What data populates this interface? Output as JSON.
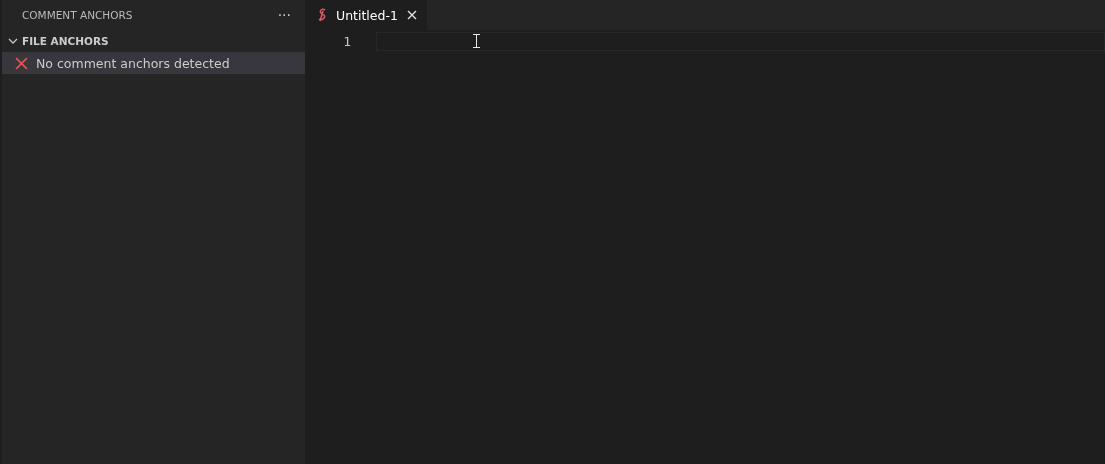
{
  "sidebar": {
    "title": "COMMENT ANCHORS",
    "more_actions": "···",
    "section": {
      "title": "FILE ANCHORS",
      "expanded": true,
      "items": [
        {
          "text": "No comment anchors detected",
          "kind": "error",
          "selected": true
        }
      ]
    }
  },
  "tabs": [
    {
      "label": "Untitled-1",
      "selected": true
    }
  ],
  "editor": {
    "lines": [
      {
        "number": "1",
        "current": true
      }
    ]
  }
}
